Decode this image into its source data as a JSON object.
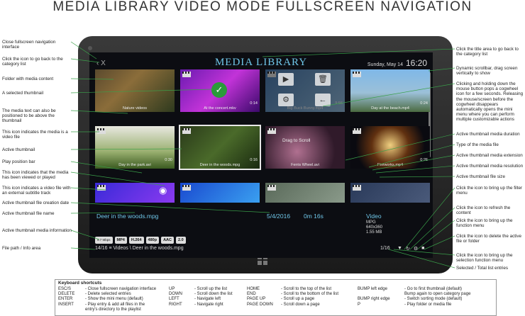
{
  "heading": "MEDIA LIBRARY VIDEO MODE FULLSCREEN NAVIGATION",
  "screen": {
    "title": "MEDIA LIBRARY",
    "nav_icons": "‹  X",
    "date": "Sunday, May 14",
    "time": "16:20",
    "thumbnails": [
      {
        "caption": "Nature videos",
        "duration": "",
        "bg": "linear-gradient(135deg,#5a4a2e,#8b6d3a 40%,#2e3a1e)"
      },
      {
        "caption": "At the concert.mkv",
        "duration": "0:14",
        "bg": "linear-gradient(135deg,#6a1bb0,#c233d8 50%,#3a0a6a)"
      },
      {
        "caption": "Big Buck Bunny.mp4",
        "duration": "9:56",
        "bg": "linear-gradient(135deg,#4a7ab0,#8fb8d8)"
      },
      {
        "caption": "Day at the beach.mp4",
        "duration": "0:24",
        "bg": "linear-gradient(180deg,#7fb8e8,#9bc0d8 55%,#4a6a40)"
      },
      {
        "caption": "Day in the park.avi",
        "duration": "0:30",
        "bg": "linear-gradient(180deg,#e8e8e0,#9ab070 60%,#3a5a20)"
      },
      {
        "caption": "Deer in the woods.mpg",
        "duration": "0:16",
        "bg": "linear-gradient(135deg,#2a3a1a,#4a6a2a 50%,#1a2a10)"
      },
      {
        "caption": "Ferris Wheel.avi",
        "duration": "",
        "bg": "radial-gradient(circle at 40% 60%,#b07090,#301a2a 70%)"
      },
      {
        "caption": "Fireworks.mp4",
        "duration": "0:26",
        "bg": "radial-gradient(circle at 50% 45%,#f0d080,#603010 40%,#0a0a10 75%)"
      },
      {
        "caption": "",
        "duration": "",
        "bg": "linear-gradient(135deg,#3a2ad8,#8a3af0)"
      },
      {
        "caption": "",
        "duration": "",
        "bg": "linear-gradient(135deg,#1a4ad0,#3aa0f0)"
      },
      {
        "caption": "",
        "duration": "",
        "bg": "linear-gradient(135deg,#5a6a5a,#8a9a8a)"
      },
      {
        "caption": "",
        "duration": "",
        "bg": "linear-gradient(135deg,#2a3a5a,#4a5a7a)"
      }
    ],
    "drag_to_scroll": "Drag to Scroll",
    "active": {
      "file_name": "Deer in the woods.mpg",
      "creation_date": "5/4/2016",
      "duration": "0m 16s",
      "type": "Video",
      "extension": "MPG",
      "resolution": "640x360",
      "file_size": "1.55 MB"
    },
    "badges": [
      "9.7 Mbps",
      "MP4",
      "H.264",
      "480p",
      "AAC",
      "2.0"
    ],
    "path": "14/16 ≡  Videos \\ Deer in the woods.mpg",
    "count": "1/16",
    "tool_icons": [
      "filter-icon",
      "refresh-icon",
      "gear-icon",
      "trash-icon"
    ]
  },
  "labels_left": [
    "Close fullscreen navigation interface",
    "Click the icon to go back to the category list",
    "Folder with media content",
    "A selected thumbnail",
    "The media text can also be positioned to be above the thumbnail",
    "This icon indicates the media is a video file",
    "Active thumbnail",
    "Play position bar",
    "This icon indicates that the media has been viewed or played",
    "This icon indicates a video file with an external subtitle track",
    "Active thumbnail file creation date",
    "Active thumbnail file name",
    "Active thumbnail media information",
    "File path / Info area"
  ],
  "labels_right": [
    "Click the title area to go back to the category list",
    "Dynamic scrollbar, drag screen vertically to show",
    "Clicking and holding down the mouse button pops a cogwheel icon for a few seconds. Releasing the mouse/screen before the cogwheel disappears automatically opens the mini menu where you can perform multiple customizable actions",
    "Active thumbnail media duration",
    "Type of the media file",
    "Active thumbnail media extension",
    "Active thumbnail media resolution",
    "Active thumbnail file size",
    "Click the icon to bring up the filter menu",
    "Click the icon to refresh the content",
    "Click the icon to bring up the function menu",
    "Click the icon to delete the active file or folder",
    "Click the icon to bring up the selection function menu",
    "Selected / Total list entries"
  ],
  "shortcuts": {
    "title": "Keyboard shortcuts",
    "columns": [
      [
        [
          "ESC/S",
          "- Close fullscreen navigation interface"
        ],
        [
          "DELETE",
          "- Delete selected entries"
        ],
        [
          "ENTER",
          "- Show the mini menu (default)"
        ],
        [
          "INSERT",
          "- Play entry & add all files in the"
        ],
        [
          "",
          "entry's directory to the playlist"
        ]
      ],
      [
        [
          "UP",
          "- Scroll up the list"
        ],
        [
          "DOWN",
          "- Scroll down the list"
        ],
        [
          "LEFT",
          "- Navigate left"
        ],
        [
          "RIGHT",
          "- Navigate right"
        ]
      ],
      [
        [
          "HOME",
          "- Scroll to the top of the list"
        ],
        [
          "END",
          "- Scroll to the bottom of the list"
        ],
        [
          "PAGE UP",
          "- Scroll up a page"
        ],
        [
          "PAGE DOWN",
          "- Scroll down a page"
        ]
      ],
      [
        [
          "BUMP left edge",
          "- Go to first thumbnail (default)"
        ],
        [
          "",
          "Bump again to open category page"
        ],
        [
          "BUMP right edge",
          "- Switch sorting mode (default)"
        ],
        [
          "P",
          "- Play folder or media file"
        ]
      ]
    ]
  }
}
